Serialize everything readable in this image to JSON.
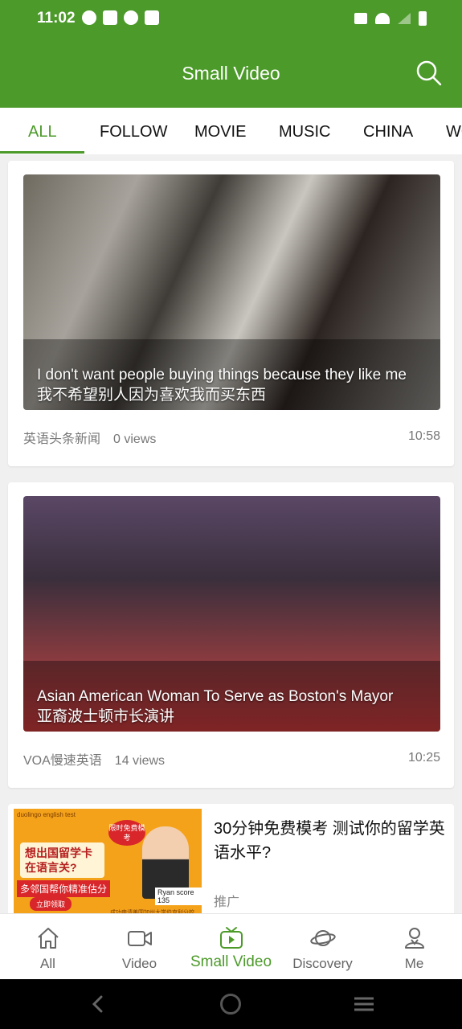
{
  "status_bar": {
    "time": "11:02"
  },
  "header": {
    "title": "Small Video"
  },
  "tabs": [
    {
      "label": "ALL",
      "active": true
    },
    {
      "label": "FOLLOW",
      "active": false
    },
    {
      "label": "MOVIE",
      "active": false
    },
    {
      "label": "MUSIC",
      "active": false
    },
    {
      "label": "CHINA",
      "active": false
    },
    {
      "label": "WO",
      "active": false
    }
  ],
  "videos": [
    {
      "caption_en": "I don't want people buying things because they like me",
      "caption_zh": "我不希望别人因为喜欢我而买东西",
      "source": "英语头条新闻",
      "views": "0 views",
      "duration": "10:58"
    },
    {
      "caption_en": "Asian American Woman To Serve as Boston's Mayor",
      "caption_zh": "亚裔波士顿市长演讲",
      "source": "VOA慢速英语",
      "views": "14 views",
      "duration": "10:25"
    }
  ],
  "ad": {
    "title": "30分钟免费模考 测试你的留学英语水平?",
    "label": "推广",
    "image_text": {
      "header": "duolingo english test",
      "headline": "想出国留学卡在语言关?",
      "subline": "多邻国帮你精准估分",
      "button": "立即领取",
      "badge": "限时免费模考",
      "name": "Ryan",
      "score": "score 135",
      "footer": "成功申请美国加州大学伯克利分校"
    }
  },
  "bottom_nav": [
    {
      "label": "All",
      "icon": "home-icon",
      "active": false
    },
    {
      "label": "Video",
      "icon": "video-camera-icon",
      "active": false
    },
    {
      "label": "Small Video",
      "icon": "tv-play-icon",
      "active": true
    },
    {
      "label": "Discovery",
      "icon": "planet-icon",
      "active": false
    },
    {
      "label": "Me",
      "icon": "person-icon",
      "active": false
    }
  ],
  "colors": {
    "brand": "#4c9a2a",
    "text_muted": "#777777"
  }
}
